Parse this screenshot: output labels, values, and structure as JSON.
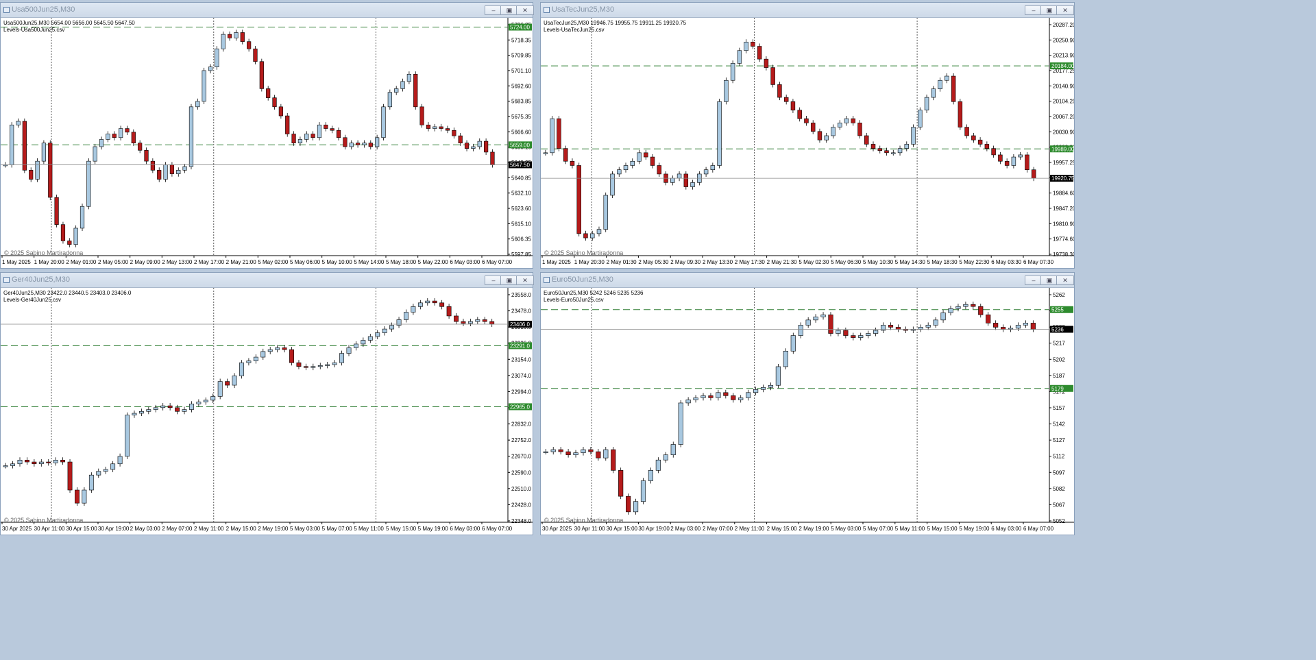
{
  "windows": [
    {
      "title": "Usa500Jun25,M30",
      "info_line": "Usa500Jun25,M30  5654.00 5656.00 5645.50 5647.50",
      "levels_line": "Levels-Usa500Jun25.csv",
      "copyright": "© 2025 Sabino Martiradonna",
      "price_ticks": [
        "5726.85",
        "5718.35",
        "5709.85",
        "5701.10",
        "5692.60",
        "5683.85",
        "5675.35",
        "5666.60",
        "5658.10",
        "5649.35",
        "5640.85",
        "5632.10",
        "5623.60",
        "5615.10",
        "5606.35",
        "5597.85"
      ],
      "time_labels": [
        "1 May 2025",
        "1 May 20:00",
        "2 May 01:00",
        "2 May 05:00",
        "2 May 09:00",
        "2 May 13:00",
        "2 May 17:00",
        "2 May 21:00",
        "5 May 02:00",
        "5 May 06:00",
        "5 May 10:00",
        "5 May 14:00",
        "5 May 18:00",
        "5 May 22:00",
        "6 May 03:00",
        "6 May 07:00"
      ],
      "level_labels": [
        "5724.00",
        "5659.00"
      ],
      "current_price": "5647.50",
      "price_range": [
        5597.85,
        5726.85
      ],
      "levels": [
        5724.0,
        5659.0
      ],
      "candles": [
        5648,
        5670,
        5672,
        5645,
        5640,
        5650,
        5660,
        5630,
        5615,
        5606,
        5604,
        5613,
        5625,
        5650,
        5658,
        5662,
        5665,
        5663,
        5668,
        5666,
        5660,
        5656,
        5650,
        5645,
        5640,
        5648,
        5643,
        5645,
        5647,
        5680,
        5683,
        5700,
        5702,
        5712,
        5720,
        5718,
        5721,
        5716,
        5712,
        5705,
        5690,
        5685,
        5680,
        5675,
        5665,
        5660,
        5662,
        5665,
        5663,
        5670,
        5668,
        5667,
        5663,
        5658,
        5660,
        5659,
        5660,
        5658,
        5663,
        5680,
        5688,
        5690,
        5694,
        5698,
        5680,
        5670,
        5668,
        5669,
        5668,
        5667,
        5664,
        5660,
        5657,
        5658,
        5661,
        5655,
        5648
      ]
    },
    {
      "title": "UsaTecJun25,M30",
      "info_line": "UsaTecJun25,M30  19946.75 19955.75 19911.25 19920.75",
      "levels_line": "Levels-UsaTecJun25.csv",
      "copyright": "© 2025 Sabino Martiradonna",
      "price_ticks": [
        "20287.20",
        "20250.90",
        "20213.90",
        "20177.25",
        "20140.90",
        "20104.25",
        "20067.20",
        "20030.90",
        "19993.90",
        "19957.25",
        "19920.75",
        "19884.60",
        "19847.20",
        "19810.90",
        "19774.60",
        "19738.30"
      ],
      "time_labels": [
        "1 May 2025",
        "1 May 20:30",
        "2 May 01:30",
        "2 May 05:30",
        "2 May 09:30",
        "2 May 13:30",
        "2 May 17:30",
        "2 May 21:30",
        "5 May 02:30",
        "5 May 06:30",
        "5 May 10:30",
        "5 May 14:30",
        "5 May 18:30",
        "5 May 22:30",
        "6 May 03:30",
        "6 May 07:30"
      ],
      "level_labels": [
        "20184.00",
        "19989.00"
      ],
      "current_price": "19920.75",
      "price_range": [
        19738.3,
        20287.2
      ],
      "levels": [
        20184.0,
        19989.0
      ],
      "candles": [
        19980,
        20060,
        19990,
        19960,
        19950,
        19790,
        19780,
        19790,
        19800,
        19880,
        19930,
        19940,
        19950,
        19960,
        19980,
        19970,
        19950,
        19930,
        19910,
        19920,
        19930,
        19900,
        19910,
        19930,
        19940,
        19950,
        20100,
        20150,
        20190,
        20220,
        20240,
        20230,
        20200,
        20180,
        20140,
        20110,
        20100,
        20080,
        20060,
        20050,
        20030,
        20010,
        20020,
        20040,
        20050,
        20060,
        20050,
        20020,
        20000,
        19990,
        19985,
        19980,
        19980,
        19990,
        20000,
        20040,
        20080,
        20110,
        20130,
        20150,
        20160,
        20100,
        20040,
        20020,
        20010,
        20000,
        19990,
        19975,
        19960,
        19950,
        19970,
        19975,
        19940,
        19920
      ]
    },
    {
      "title": "Ger40Jun25,M30",
      "info_line": "Ger40Jun25,M30  23422.0 23440.5 23403.0 23406.0",
      "levels_line": "Levels-Ger40Jun25.csv",
      "copyright": "© 2025 Sabino Martiradonna",
      "price_ticks": [
        "23558.0",
        "23478.0",
        "23316.0",
        "23236.0",
        "23154.0",
        "23074.0",
        "22994.0",
        "22912.0",
        "22832.0",
        "22752.0",
        "22670.0",
        "22590.0",
        "22510.0",
        "22428.0",
        "22348.0"
      ],
      "time_labels": [
        "30 Apr 2025",
        "30 Apr 11:00",
        "30 Apr 15:00",
        "30 Apr 19:00",
        "2 May 03:00",
        "2 May 07:00",
        "2 May 11:00",
        "2 May 15:00",
        "2 May 19:00",
        "5 May 03:00",
        "5 May 07:00",
        "5 May 11:00",
        "5 May 15:00",
        "5 May 19:00",
        "6 May 03:00",
        "6 May 07:00"
      ],
      "level_labels": [
        "23291.0",
        "22965.0"
      ],
      "current_price": "23406.0",
      "price_range": [
        22348.0,
        23578.0
      ],
      "levels": [
        23291.0,
        22965.0
      ],
      "candles": [
        22650,
        22660,
        22680,
        22670,
        22660,
        22670,
        22665,
        22680,
        22670,
        22520,
        22450,
        22520,
        22600,
        22620,
        22630,
        22660,
        22700,
        22920,
        22930,
        22940,
        22950,
        22960,
        22970,
        22960,
        22940,
        22950,
        22980,
        22990,
        23000,
        23020,
        23100,
        23080,
        23130,
        23200,
        23210,
        23230,
        23260,
        23270,
        23280,
        23270,
        23200,
        23180,
        23175,
        23180,
        23185,
        23190,
        23200,
        23250,
        23280,
        23300,
        23320,
        23340,
        23360,
        23380,
        23400,
        23430,
        23470,
        23500,
        23520,
        23530,
        23520,
        23500,
        23450,
        23420,
        23410,
        23420,
        23430,
        23420,
        23406
      ]
    },
    {
      "title": "Euro50Jun25,M30",
      "info_line": "Euro50Jun25,M30  5242 5246 5235 5236",
      "levels_line": "Levels-Euro50Jun25.csv",
      "copyright": "© 2025 Sabino Martiradonna",
      "price_ticks": [
        "5262",
        "5247",
        "5232",
        "5217",
        "5202",
        "5187",
        "5172",
        "5157",
        "5142",
        "5127",
        "5112",
        "5097",
        "5082",
        "5067",
        "5052"
      ],
      "time_labels": [
        "30 Apr 2025",
        "30 Apr 11:00",
        "30 Apr 15:00",
        "30 Apr 19:00",
        "2 May 03:00",
        "2 May 07:00",
        "2 May 11:00",
        "2 May 15:00",
        "2 May 19:00",
        "5 May 03:00",
        "5 May 07:00",
        "5 May 11:00",
        "5 May 15:00",
        "5 May 19:00",
        "6 May 03:00",
        "6 May 07:00"
      ],
      "level_labels": [
        "5255",
        "5179"
      ],
      "current_price": "5236",
      "price_range": [
        5050.0,
        5272.0
      ],
      "levels": [
        5255.0,
        5179.0
      ],
      "candles": [
        5118,
        5120,
        5118,
        5115,
        5117,
        5120,
        5118,
        5112,
        5120,
        5100,
        5075,
        5060,
        5070,
        5090,
        5100,
        5110,
        5115,
        5125,
        5165,
        5168,
        5170,
        5172,
        5170,
        5175,
        5172,
        5168,
        5170,
        5175,
        5178,
        5180,
        5182,
        5200,
        5215,
        5230,
        5240,
        5245,
        5248,
        5250,
        5232,
        5235,
        5230,
        5228,
        5230,
        5232,
        5235,
        5240,
        5238,
        5236,
        5235,
        5236,
        5238,
        5240,
        5245,
        5252,
        5256,
        5258,
        5260,
        5258,
        5250,
        5242,
        5238,
        5236,
        5237,
        5240,
        5242,
        5236
      ]
    }
  ]
}
